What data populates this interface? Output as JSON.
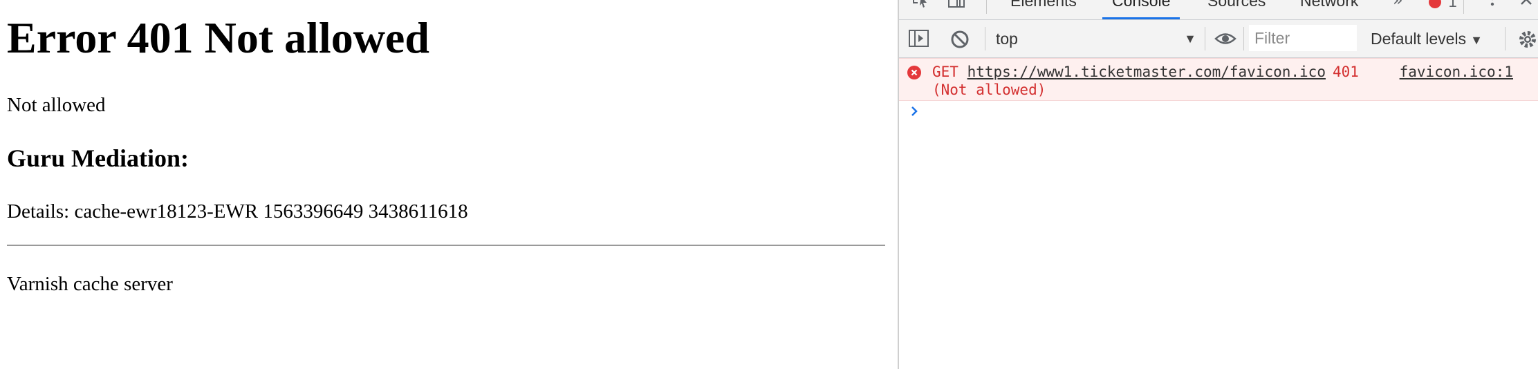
{
  "page": {
    "heading": "Error 401 Not allowed",
    "message": "Not allowed",
    "subheading": "Guru Mediation:",
    "details": "Details: cache-ewr18123-EWR 1563396649 3438611618",
    "footer": "Varnish cache server"
  },
  "devtools": {
    "tabs": [
      "Elements",
      "Console",
      "Sources",
      "Network"
    ],
    "active_tab": "Console",
    "more_tabs_icon": "double-chevron-icon",
    "error_count": "1",
    "toolbar": {
      "context": "top",
      "filter_placeholder": "Filter",
      "levels": "Default levels"
    },
    "console": {
      "method": "GET",
      "url": "https://www1.ticketmaster.com/favicon.ico",
      "status_code": "401",
      "status_text": "(Not allowed)",
      "source": "favicon.ico:1"
    }
  },
  "colors": {
    "accent": "#1a73e8",
    "error": "#d32f2f",
    "error_bg": "#fef0ef"
  }
}
